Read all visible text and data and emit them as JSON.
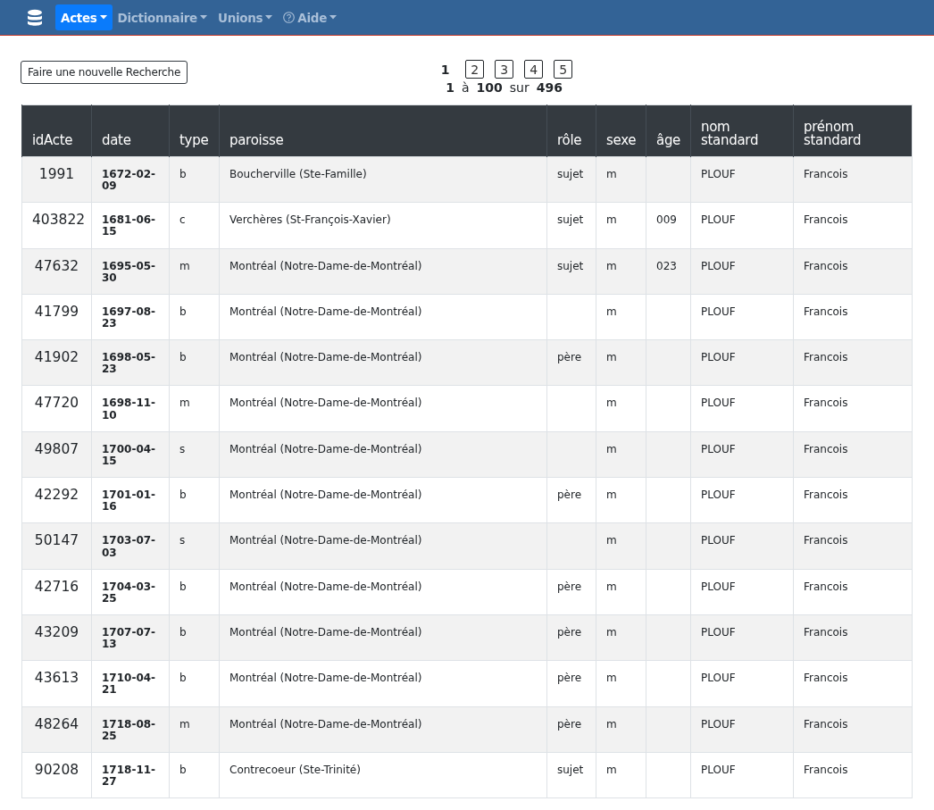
{
  "navbar": {
    "items": [
      {
        "label": "Actes",
        "selected": true,
        "help": false
      },
      {
        "label": "Dictionnaire",
        "selected": false,
        "help": false
      },
      {
        "label": "Unions",
        "selected": false,
        "help": false
      },
      {
        "label": "Aide",
        "selected": false,
        "help": true
      }
    ]
  },
  "new_search_button": "Faire une nouvelle Recherche",
  "pagination": {
    "pages": [
      {
        "label": "1",
        "selected": true
      },
      {
        "label": "2",
        "selected": false
      },
      {
        "label": "3",
        "selected": false
      },
      {
        "label": "4",
        "selected": false
      },
      {
        "label": "5",
        "selected": false
      }
    ],
    "range": {
      "from": "1",
      "to_word": "à",
      "to": "100",
      "of_word": "sur",
      "total": "496"
    }
  },
  "table": {
    "columns": [
      "idActe",
      "date",
      "type",
      "paroisse",
      "rôle",
      "sexe",
      "âge",
      "nom standard",
      "prénom standard"
    ],
    "rows": [
      [
        "1991",
        "1672-02-09",
        "b",
        "Boucherville (Ste-Famille)",
        "sujet",
        "m",
        "",
        "PLOUF",
        "Francois"
      ],
      [
        "403822",
        "1681-06-15",
        "c",
        "Verchères (St-François-Xavier)",
        "sujet",
        "m",
        "009",
        "PLOUF",
        "Francois"
      ],
      [
        "47632",
        "1695-05-30",
        "m",
        "Montréal (Notre-Dame-de-Montréal)",
        "sujet",
        "m",
        "023",
        "PLOUF",
        "Francois"
      ],
      [
        "41799",
        "1697-08-23",
        "b",
        "Montréal (Notre-Dame-de-Montréal)",
        "",
        "m",
        "",
        "PLOUF",
        "Francois"
      ],
      [
        "41902",
        "1698-05-23",
        "b",
        "Montréal (Notre-Dame-de-Montréal)",
        "père",
        "m",
        "",
        "PLOUF",
        "Francois"
      ],
      [
        "47720",
        "1698-11-10",
        "m",
        "Montréal (Notre-Dame-de-Montréal)",
        "",
        "m",
        "",
        "PLOUF",
        "Francois"
      ],
      [
        "49807",
        "1700-04-15",
        "s",
        "Montréal (Notre-Dame-de-Montréal)",
        "",
        "m",
        "",
        "PLOUF",
        "Francois"
      ],
      [
        "42292",
        "1701-01-16",
        "b",
        "Montréal (Notre-Dame-de-Montréal)",
        "père",
        "m",
        "",
        "PLOUF",
        "Francois"
      ],
      [
        "50147",
        "1703-07-03",
        "s",
        "Montréal (Notre-Dame-de-Montréal)",
        "",
        "m",
        "",
        "PLOUF",
        "Francois"
      ],
      [
        "42716",
        "1704-03-25",
        "b",
        "Montréal (Notre-Dame-de-Montréal)",
        "père",
        "m",
        "",
        "PLOUF",
        "Francois"
      ],
      [
        "43209",
        "1707-07-13",
        "b",
        "Montréal (Notre-Dame-de-Montréal)",
        "père",
        "m",
        "",
        "PLOUF",
        "Francois"
      ],
      [
        "43613",
        "1710-04-21",
        "b",
        "Montréal (Notre-Dame-de-Montréal)",
        "père",
        "m",
        "",
        "PLOUF",
        "Francois"
      ],
      [
        "48264",
        "1718-08-25",
        "m",
        "Montréal (Notre-Dame-de-Montréal)",
        "père",
        "m",
        "",
        "PLOUF",
        "Francois"
      ],
      [
        "90208",
        "1718-11-27",
        "b",
        "Contrecoeur (Ste-Trinité)",
        "sujet",
        "m",
        "",
        "PLOUF",
        "Francois"
      ]
    ]
  }
}
